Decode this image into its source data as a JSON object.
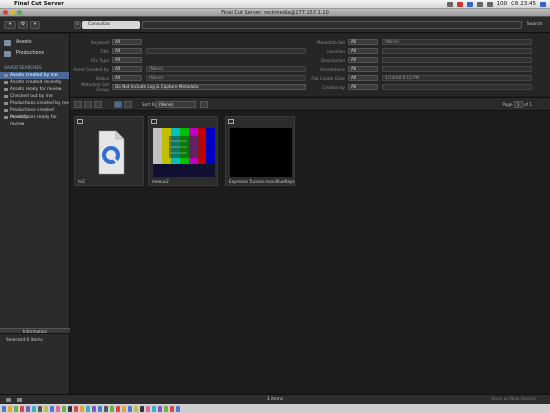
{
  "menubar": {
    "apple": "",
    "app_name": "Final Cut Server",
    "clock": "Сб 23:45",
    "battery": "100"
  },
  "window": {
    "title": "Final Cut Server: reckmedia@177.157.1.10"
  },
  "toolbar": {
    "search_scope": "Consultas interessantes",
    "search_placeholder": "",
    "search_button": "Search"
  },
  "sidebar": {
    "top_items": [
      "Assets",
      "Productions"
    ],
    "section_title": "SAVED SEARCHES",
    "saved_searches": [
      "Assets created by me",
      "Assets created recently",
      "Assets ready for review",
      "Checked out by me",
      "Productions created by me",
      "Productions created recently",
      "Productions ready for review"
    ],
    "info_header": "Information",
    "info_text": "Selected 0 items"
  },
  "filters": {
    "left": [
      {
        "label": "Keyword",
        "value": "All",
        "extra": ""
      },
      {
        "label": "Title",
        "value": "All",
        "extra": ""
      },
      {
        "label": "File Type",
        "value": "All",
        "extra": ""
      },
      {
        "label": "Asset Created by",
        "value": "All",
        "extra": "(None)"
      },
      {
        "label": "Status",
        "value": "All",
        "extra": "(None)"
      },
      {
        "label": "Metadata Set Group",
        "value": "Do Not Include Log & Capture Metadata",
        "extra": ""
      }
    ],
    "right": [
      {
        "label": "Metadata Set",
        "value": "All",
        "extra": "(None)"
      },
      {
        "label": "Location",
        "value": "All",
        "extra": ""
      },
      {
        "label": "Description",
        "value": "All",
        "extra": ""
      },
      {
        "label": "Annotations",
        "value": "All",
        "extra": ""
      },
      {
        "label": "File Create Date",
        "value": "All",
        "extra": "1/14/08 6:15 PM"
      },
      {
        "label": "Created by",
        "value": "All",
        "extra": ""
      }
    ]
  },
  "viewbar": {
    "sort_label": "Sort By",
    "sort_value": "(None)",
    "page_label": "Page",
    "page_current": "1",
    "page_of": "of 1"
  },
  "assets": [
    {
      "name": "m2",
      "kind": "quicktime-doc"
    },
    {
      "name": "meeus2",
      "kind": "color-bars"
    },
    {
      "name": "Expresso Tucano.mov.BlueRays",
      "kind": "black"
    }
  ],
  "statusbar": {
    "count": "3 items",
    "save": "Save as New Search"
  }
}
